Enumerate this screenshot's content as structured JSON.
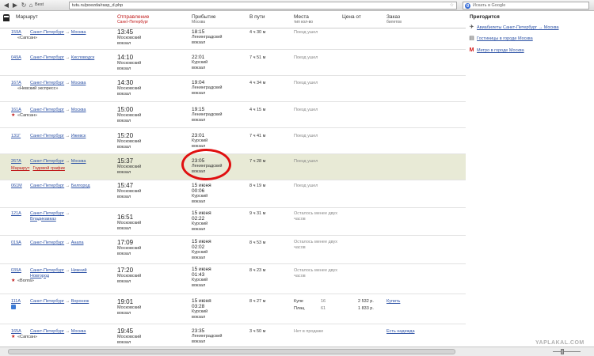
{
  "browser": {
    "bookmark_label": "Best",
    "url": "tutu.ru/poezda/rasp_d.php",
    "search_placeholder": "Искать в Google"
  },
  "table_header": {
    "route": "Маршрут",
    "departure": "Отправление",
    "departure_sub": "Санкт-Петербург",
    "arrival": "Прибытие",
    "arrival_sub": "Москва",
    "duration": "В пути",
    "seats": "Места",
    "seats_sub": "тип кол-во",
    "price": "Цена от",
    "order": "Заказ",
    "order_sub": "билетов"
  },
  "rows": [
    {
      "num": "159А",
      "from": "Санкт-Петербург",
      "to": "Москва",
      "name": "«Сапсан»",
      "dep_time": "13:45",
      "dep_station": [
        "Московский",
        "вокзал"
      ],
      "arr_date": "",
      "arr_time": "18:15",
      "arr_station": [
        "Ленинградский",
        "вокзал"
      ],
      "dur": "4 ч 30 м",
      "seats": "Поезд ушел"
    },
    {
      "num": "049А",
      "from": "Санкт-Петербург",
      "to": "Кисловодск",
      "name": "",
      "dep_time": "14:10",
      "dep_station": [
        "Московский",
        "вокзал"
      ],
      "arr_date": "",
      "arr_time": "22:01",
      "arr_station": [
        "Курский",
        "вокзал"
      ],
      "dur": "7 ч 51 м",
      "seats": "Поезд ушел"
    },
    {
      "num": "167А",
      "from": "Санкт-Петербург",
      "to": "Москва",
      "name": "«Невский экспресс»",
      "dep_time": "14:30",
      "dep_station": [
        "Московский",
        "вокзал"
      ],
      "arr_date": "",
      "arr_time": "19:04",
      "arr_station": [
        "Ленинградский",
        "вокзал"
      ],
      "dur": "4 ч 34 м",
      "seats": "Поезд ушел"
    },
    {
      "num": "161А",
      "from": "Санкт-Петербург",
      "to": "Москва",
      "name": "«Сапсан»",
      "dep_time": "15:00",
      "dep_station": [
        "Московский",
        "вокзал"
      ],
      "arr_date": "",
      "arr_time": "19:15",
      "arr_station": [
        "Ленинградский",
        "вокзал"
      ],
      "dur": "4 ч 15 м",
      "seats": "Поезд ушел"
    },
    {
      "num": "131Г",
      "from": "Санкт-Петербург",
      "to": "Ижевск",
      "name": "",
      "dep_time": "15:20",
      "dep_station": [
        "Московский",
        "вокзал"
      ],
      "arr_date": "",
      "arr_time": "23:01",
      "arr_station": [
        "Курский",
        "вокзал"
      ],
      "dur": "7 ч 41 м",
      "seats": "Поезд ушел"
    },
    {
      "num": "267А",
      "from": "Санкт-Петербург",
      "to": "Москва",
      "name": "",
      "dep_time": "15:37",
      "dep_station": [
        "Московский",
        "вокзал"
      ],
      "arr_date": "",
      "arr_time": "23:05",
      "arr_station": [
        "Ленинградский",
        "вокзал"
      ],
      "dur": "7 ч 28 м",
      "seats": "Поезд ушел",
      "links": [
        "Маршрут",
        "Годовой график"
      ]
    },
    {
      "num": "061М",
      "from": "Санкт-Петербург",
      "to": "Белгород",
      "name": "",
      "dep_time": "15:47",
      "dep_station": [
        "Московский",
        "вокзал"
      ],
      "arr_date": "15 июня",
      "arr_time": "00:06",
      "arr_station": [
        "Курский",
        "вокзал"
      ],
      "dur": "8 ч 19 м",
      "seats": "Поезд ушел"
    },
    {
      "num": "121А",
      "from": "Санкт-Петербург",
      "to": "Владикавказ",
      "name": "",
      "dep_time": "16:51",
      "dep_station": [
        "Московский",
        "вокзал"
      ],
      "arr_date": "15 июня",
      "arr_time": "02:22",
      "arr_station": [
        "Курский",
        "вокзал"
      ],
      "dur": "9 ч 31 м",
      "seats": "Осталось менее двух часов"
    },
    {
      "num": "019А",
      "from": "Санкт-Петербург",
      "to": "Анапа",
      "name": "",
      "dep_time": "17:09",
      "dep_station": [
        "Московский",
        "вокзал"
      ],
      "arr_date": "15 июня",
      "arr_time": "02:02",
      "arr_station": [
        "Курский",
        "вокзал"
      ],
      "dur": "8 ч 53 м",
      "seats": "Осталось менее двух часов"
    },
    {
      "num": "039А",
      "from": "Санкт-Петербург",
      "to": "Нижний Новгород",
      "name": "«Волга»",
      "dep_time": "17:20",
      "dep_station": [
        "Московский",
        "вокзал"
      ],
      "arr_date": "15 июня",
      "arr_time": "01:43",
      "arr_station": [
        "Курский",
        "вокзал"
      ],
      "dur": "8 ч 23 м",
      "seats": "Осталось менее двух часов"
    },
    {
      "num": "111А",
      "from": "Санкт-Петербург",
      "to": "Воронеж",
      "name": "",
      "dep_time": "19:01",
      "dep_station": [
        "Московский",
        "вокзал"
      ],
      "arr_date": "15 июня",
      "arr_time": "03:28",
      "arr_station": [
        "Курский",
        "вокзал"
      ],
      "dur": "8 ч 27 м",
      "classes": [
        {
          "type": "Купе",
          "count": "16",
          "price": "2 532 р."
        },
        {
          "type": "Плац",
          "count": "61",
          "price": "1 833 р."
        }
      ],
      "buy": "Купить"
    },
    {
      "num": "165А",
      "from": "Санкт-Петербург",
      "to": "Москва",
      "name": "«Сапсан»",
      "dep_time": "19:45",
      "dep_station": [
        "Московский",
        "вокзал"
      ],
      "arr_date": "",
      "arr_time": "23:35",
      "arr_station": [
        "Ленинградский",
        "вокзал"
      ],
      "dur": "3 ч 50 м",
      "seats": "Нет в продаже",
      "buy": "Есть надежда"
    }
  ],
  "sidebar": {
    "title": "Пригодится",
    "links": [
      {
        "label": "Авиабилеты Санкт-Петербург → Москва",
        "icon": "airplane-icon"
      },
      {
        "label": "Гостиницы в городе Москва",
        "icon": "hotel-icon"
      },
      {
        "label": "Метро в городе Москва",
        "icon": "metro-icon"
      }
    ]
  },
  "watermark": "YAPLAKAL.COM",
  "colors": {
    "link": "#2e53a6",
    "accent_red": "#c01818",
    "highlight": "#e8ead6",
    "circle": "#e01010"
  }
}
